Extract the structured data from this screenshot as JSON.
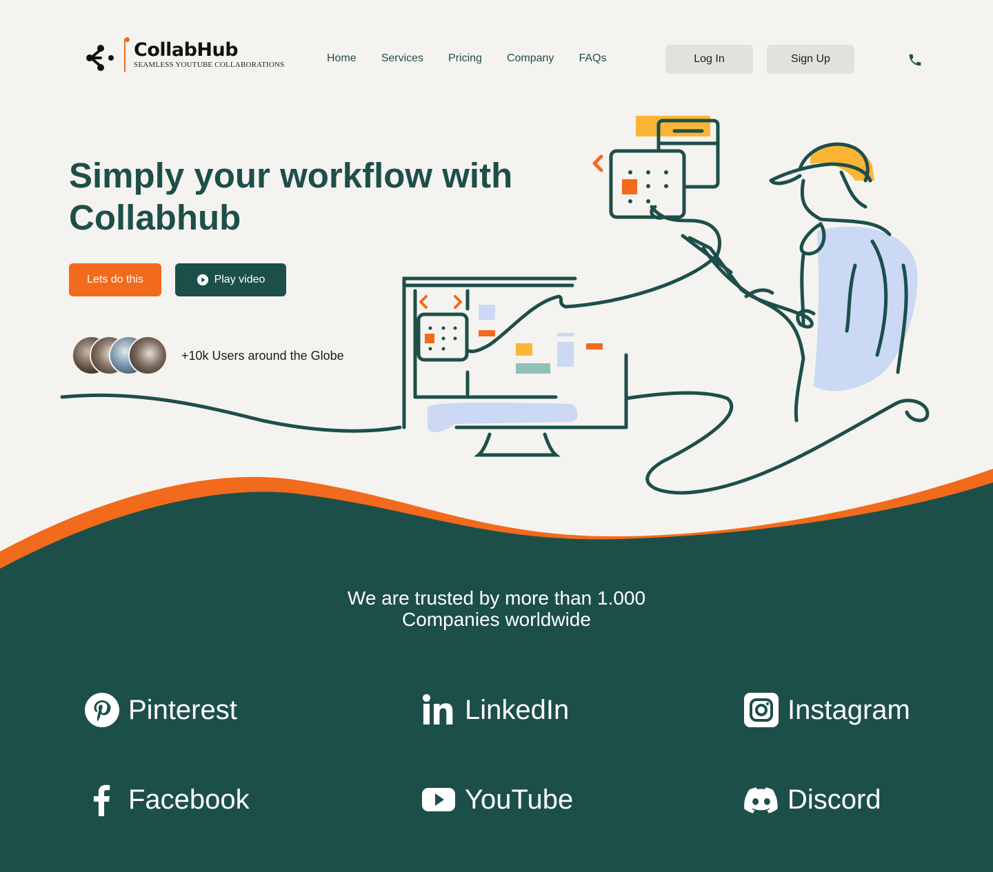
{
  "brand": {
    "name": "CollabHub",
    "tagline": "SEAMLESS YOUTUBE COLLABORATIONS"
  },
  "nav": {
    "items": [
      "Home",
      "Services",
      "Pricing",
      "Company",
      "FAQs"
    ]
  },
  "auth": {
    "login_label": "Log In",
    "signup_label": "Sign Up"
  },
  "hero": {
    "title_line1": "Simply your workflow with",
    "title_line2": "Collabhub",
    "primary_label": "Lets do this",
    "video_label": "Play video",
    "users_text": "+10k Users around the Globe"
  },
  "trusted": {
    "line1": "We are trusted by more than 1.000",
    "line2": "Companies worldwide"
  },
  "partners": [
    {
      "label": "Pinterest",
      "icon": "pinterest-icon"
    },
    {
      "label": "LinkedIn",
      "icon": "linkedin-icon"
    },
    {
      "label": "Instagram",
      "icon": "instagram-icon"
    },
    {
      "label": "Facebook",
      "icon": "facebook-icon"
    },
    {
      "label": "YouTube",
      "icon": "youtube-icon"
    },
    {
      "label": "Discord",
      "icon": "discord-icon"
    }
  ],
  "colors": {
    "primary": "#1d4f4a",
    "accent": "#f26a1b",
    "background": "#f5f3ef",
    "button_gray": "#dfe2dd",
    "yellow": "#fbb536",
    "light_blue": "#cbd9f5"
  }
}
